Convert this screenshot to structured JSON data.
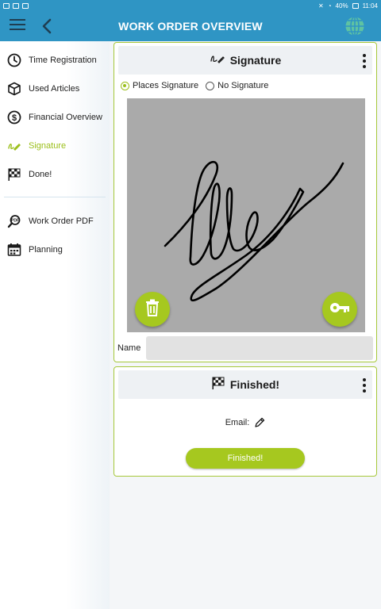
{
  "status_bar": {
    "battery": "40%",
    "time": "11:04"
  },
  "app_bar": {
    "title": "WORK ORDER OVERVIEW"
  },
  "sidebar": {
    "items": [
      {
        "label": "Time Registration",
        "icon": "clock-icon"
      },
      {
        "label": "Used Articles",
        "icon": "box-icon"
      },
      {
        "label": "Financial Overview",
        "icon": "dollar-coin-icon"
      },
      {
        "label": "Signature",
        "icon": "signature-icon",
        "active": true
      },
      {
        "label": "Done!",
        "icon": "checkered-flag-icon"
      },
      {
        "label": "Work Order PDF",
        "icon": "pdf-search-icon"
      },
      {
        "label": "Planning",
        "icon": "calendar-icon"
      }
    ]
  },
  "signature_card": {
    "title": "Signature",
    "radio_signature": "Places Signature",
    "radio_no_signature": "No Signature",
    "selected": "Places Signature",
    "name_label": "Name",
    "name_value": ""
  },
  "finished_card": {
    "title": "Finished!",
    "email_label": "Email:",
    "button_label": "Finished!"
  },
  "colors": {
    "primary": "#2f95c4",
    "accent": "#a6c81f",
    "active_text": "#9bbf1a"
  }
}
